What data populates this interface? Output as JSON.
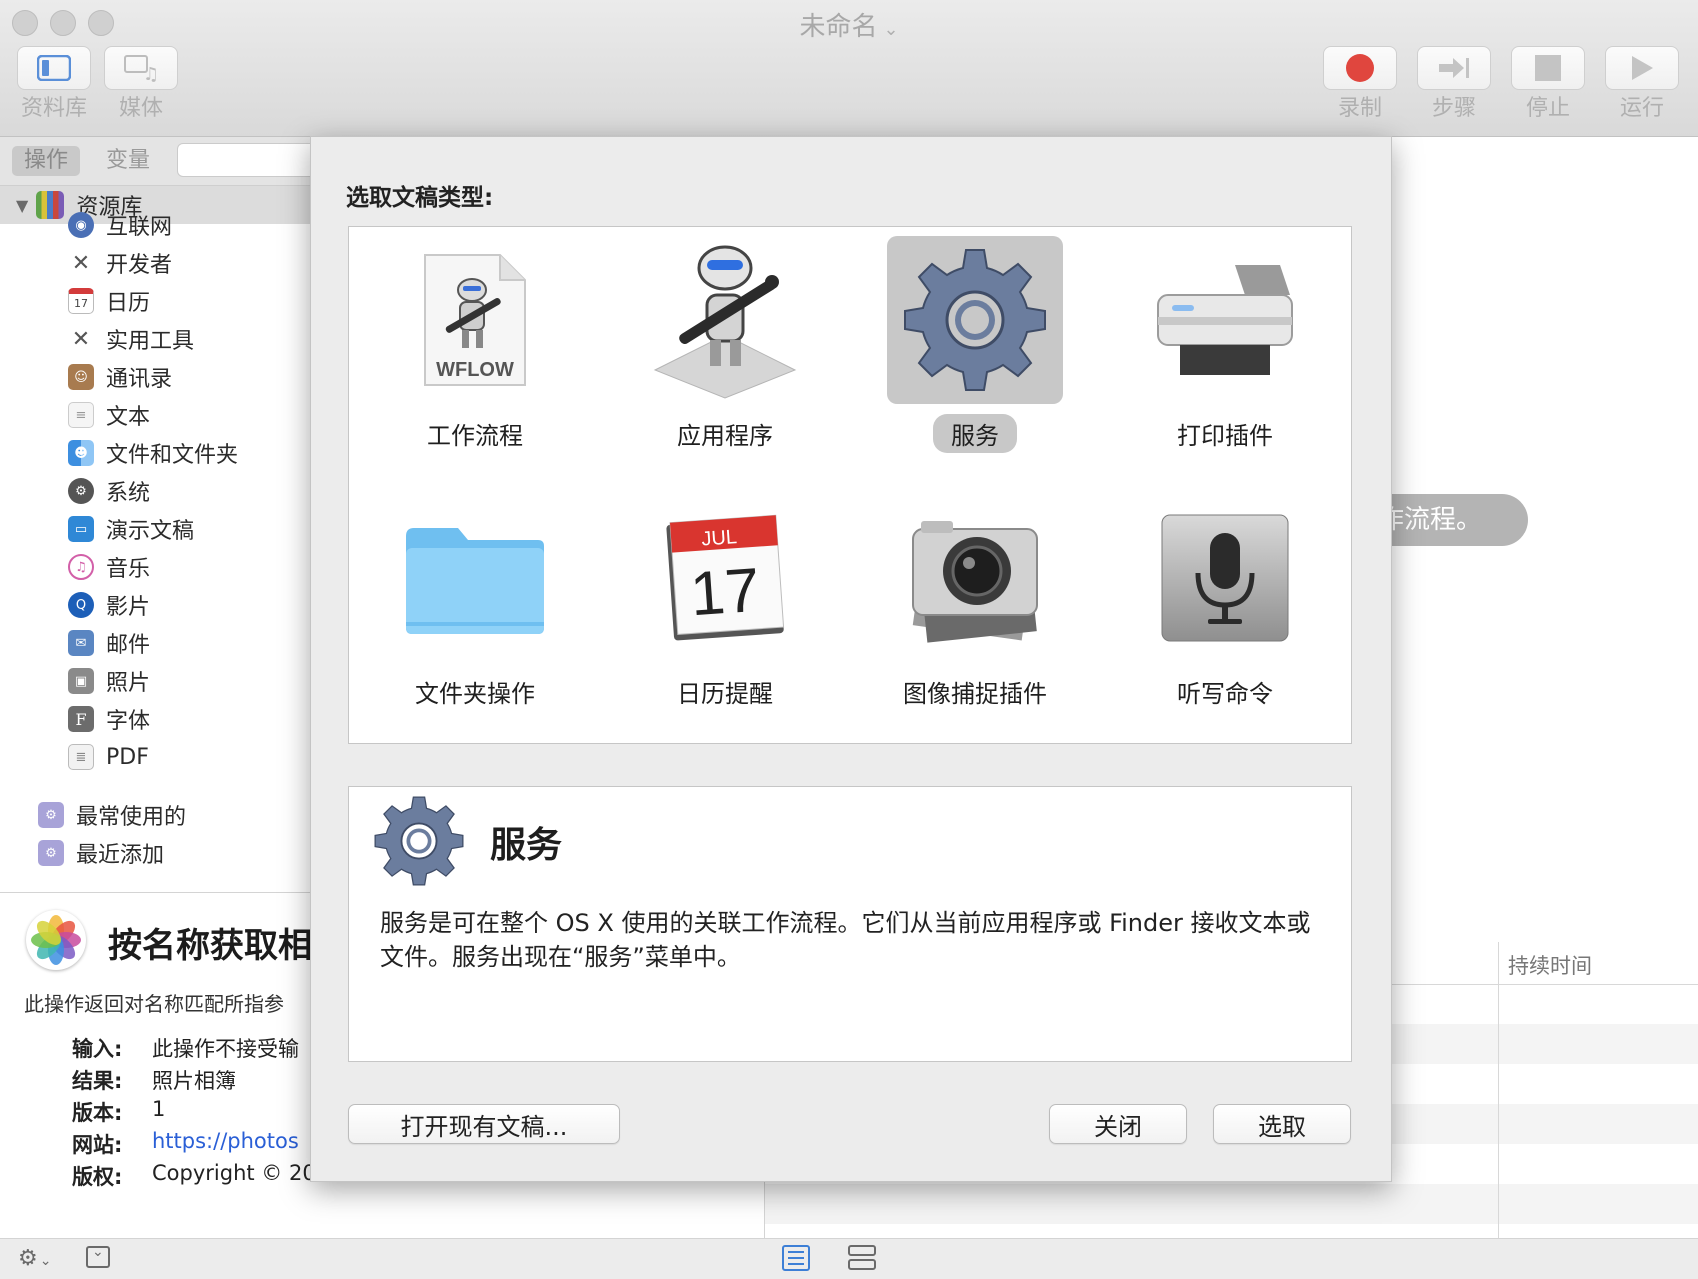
{
  "window": {
    "title": "未命名"
  },
  "toolbar": {
    "left": [
      {
        "label": "资料库",
        "icon": "library-icon"
      },
      {
        "label": "媒体",
        "icon": "media-icon"
      }
    ],
    "right": [
      {
        "label": "录制",
        "icon": "record-icon"
      },
      {
        "label": "步骤",
        "icon": "step-icon"
      },
      {
        "label": "停止",
        "icon": "stop-icon"
      },
      {
        "label": "运行",
        "icon": "run-icon"
      }
    ]
  },
  "library": {
    "tabs": [
      "操作",
      "变量"
    ],
    "root_label": "资源库",
    "items": [
      {
        "label": "互联网",
        "icon": "globe-icon",
        "color": "#4a6fb5"
      },
      {
        "label": "开发者",
        "icon": "tools-icon",
        "color": "#7a7a7a"
      },
      {
        "label": "日历",
        "icon": "calendar-icon",
        "color": "#d33b3b"
      },
      {
        "label": "实用工具",
        "icon": "utilities-icon",
        "color": "#7a7a7a"
      },
      {
        "label": "通讯录",
        "icon": "contacts-icon",
        "color": "#a87b4f"
      },
      {
        "label": "文本",
        "icon": "text-icon",
        "color": "#bcbcbc"
      },
      {
        "label": "文件和文件夹",
        "icon": "finder-icon",
        "color": "#3d8fe0"
      },
      {
        "label": "系统",
        "icon": "system-icon",
        "color": "#555555"
      },
      {
        "label": "演示文稿",
        "icon": "keynote-icon",
        "color": "#2f88d6"
      },
      {
        "label": "音乐",
        "icon": "music-icon",
        "color": "#d25fa8"
      },
      {
        "label": "影片",
        "icon": "movie-icon",
        "color": "#1d5fb8"
      },
      {
        "label": "邮件",
        "icon": "mail-icon",
        "color": "#5a86c2"
      },
      {
        "label": "照片",
        "icon": "photos-icon",
        "color": "#8a8a8a"
      },
      {
        "label": "字体",
        "icon": "font-icon",
        "color": "#6c6c6c"
      },
      {
        "label": "PDF",
        "icon": "pdf-icon",
        "color": "#9a9a9a"
      }
    ],
    "smart_folders": [
      {
        "label": "最常使用的",
        "icon": "smart-folder-icon"
      },
      {
        "label": "最近添加",
        "icon": "smart-folder-icon"
      }
    ]
  },
  "info": {
    "title": "按名称获取相",
    "description": "此操作返回对名称匹配所指参",
    "rows": [
      {
        "key": "输入:",
        "value": "此操作不接受输"
      },
      {
        "key": "结果:",
        "value": "照片相簿"
      },
      {
        "key": "版本:",
        "value": "1"
      },
      {
        "key": "网站:",
        "value": "https://photos"
      },
      {
        "key": "版权:",
        "value": "Copyright © 20"
      }
    ]
  },
  "workflow": {
    "hint": "作流程。",
    "log_column": "持续时间"
  },
  "dialog": {
    "prompt": "选取文稿类型:",
    "types": [
      {
        "label": "工作流程",
        "icon": "workflow-document-icon",
        "badge": "WFLOW",
        "selected": false
      },
      {
        "label": "应用程序",
        "icon": "automator-robot-icon",
        "selected": false
      },
      {
        "label": "服务",
        "icon": "gear-icon",
        "selected": true
      },
      {
        "label": "打印插件",
        "icon": "printer-icon",
        "selected": false
      },
      {
        "label": "文件夹操作",
        "icon": "folder-icon",
        "selected": false
      },
      {
        "label": "日历提醒",
        "icon": "calendar-alarm-icon",
        "month": "JUL",
        "day": "17",
        "selected": false
      },
      {
        "label": "图像捕捉插件",
        "icon": "camera-icon",
        "selected": false
      },
      {
        "label": "听写命令",
        "icon": "microphone-icon",
        "selected": false
      }
    ],
    "detail": {
      "title": "服务",
      "text": "服务是可在整个 OS X 使用的关联工作流程。它们从当前应用程序或 Finder 接收文本或文件。服务出现在“服务”菜单中。"
    },
    "buttons": {
      "open_existing": "打开现有文稿...",
      "close": "关闭",
      "choose": "选取"
    }
  },
  "colors": {
    "record_red": "#e0463e",
    "selection_gray": "#c8c8c8",
    "link_blue": "#2a5fd6"
  }
}
